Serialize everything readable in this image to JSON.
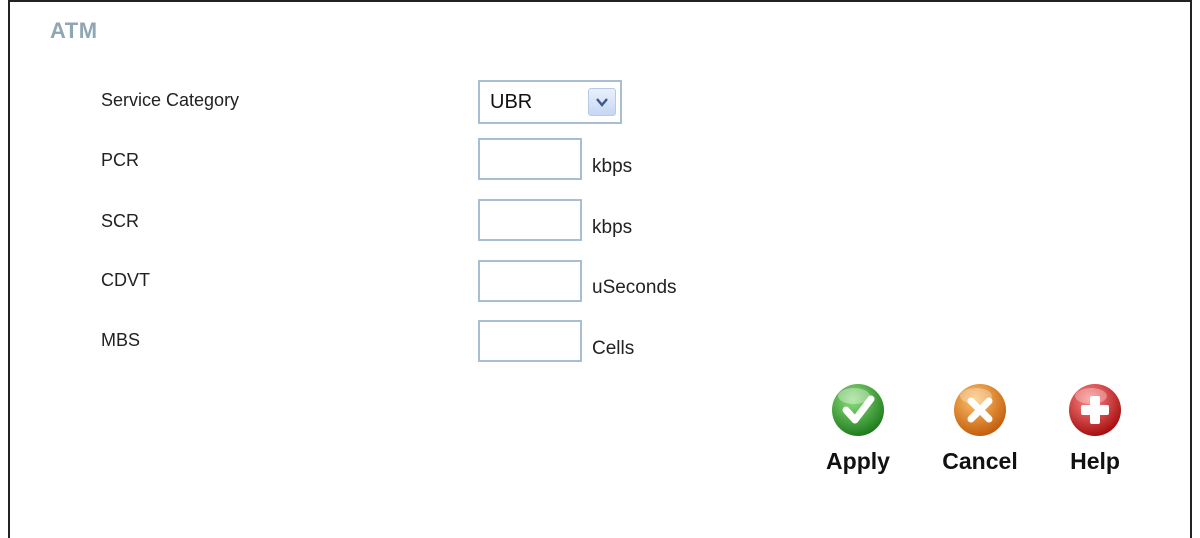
{
  "section": {
    "title": "ATM"
  },
  "fields": {
    "service_category": {
      "label": "Service Category",
      "value": "UBR"
    },
    "pcr": {
      "label": "PCR",
      "value": "",
      "unit": "kbps"
    },
    "scr": {
      "label": "SCR",
      "value": "",
      "unit": "kbps"
    },
    "cdvt": {
      "label": "CDVT",
      "value": "",
      "unit": "uSeconds"
    },
    "mbs": {
      "label": "MBS",
      "value": "",
      "unit": "Cells"
    }
  },
  "actions": {
    "apply": {
      "label": "Apply",
      "icon": "check-icon",
      "color": "#3aa033"
    },
    "cancel": {
      "label": "Cancel",
      "icon": "close-icon",
      "color": "#e0821e"
    },
    "help": {
      "label": "Help",
      "icon": "plus-icon",
      "color": "#d42323"
    }
  },
  "colors": {
    "title": "#8fa7b2",
    "field_border": "#a9bed0"
  }
}
